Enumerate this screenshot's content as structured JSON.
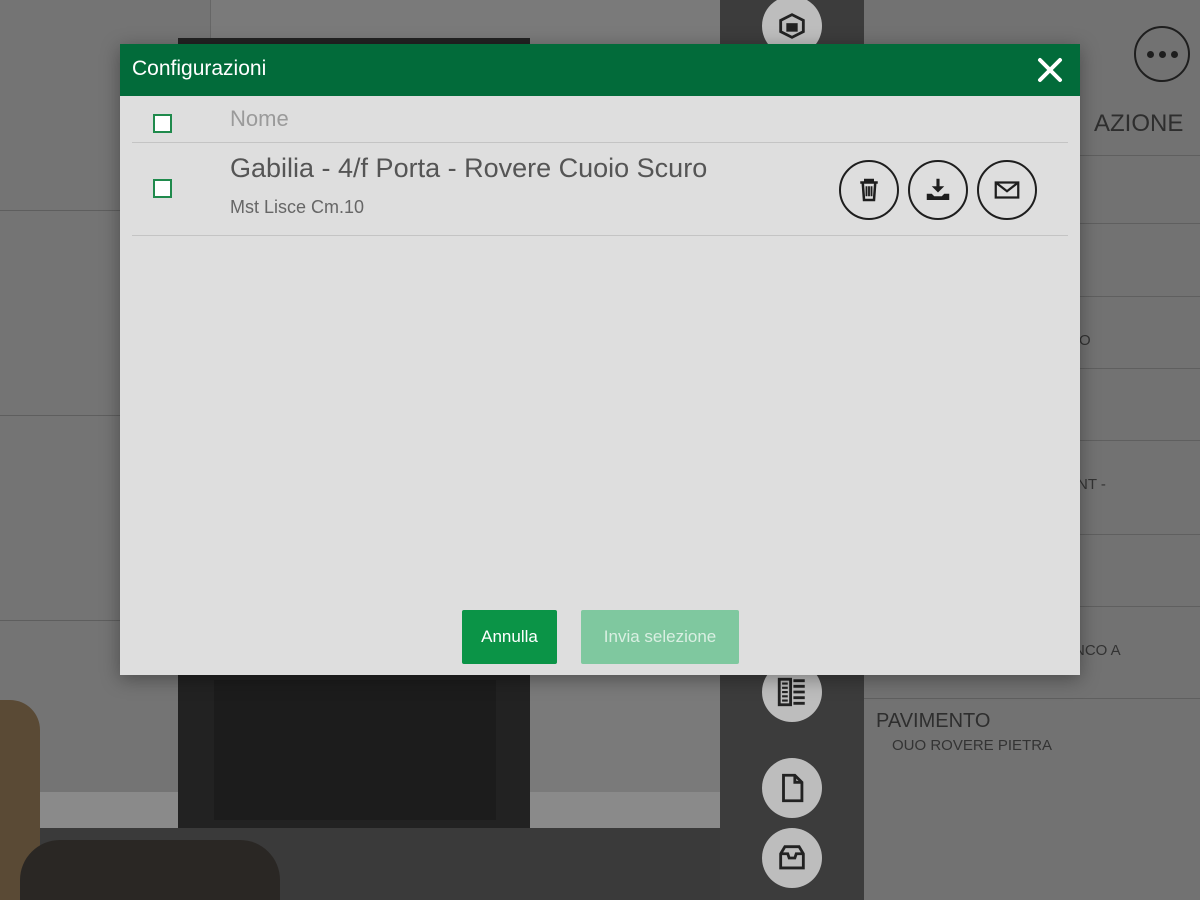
{
  "colors": {
    "header_green": "#026b3a",
    "button_green": "#0b9447",
    "button_disabled": "#7fc89f",
    "modal_bg": "#dedede"
  },
  "background_panel": {
    "more_button_icon": "more-dots-icon",
    "lines": [
      {
        "text": "AZIONE",
        "size": "large"
      },
      {
        "text": "O",
        "size": "small"
      },
      {
        "text": "NT -",
        "size": "small"
      },
      {
        "text": "NCO A",
        "size": "small"
      },
      {
        "text": "PAVIMENTO",
        "size": "large"
      },
      {
        "text": "OUO ROVERE PIETRA",
        "size": "small"
      }
    ]
  },
  "toolbar": {
    "icons": [
      "3d-cube-icon",
      "pattern-icon",
      "document-icon",
      "archive-box-icon"
    ]
  },
  "modal": {
    "title": "Configurazioni",
    "close_icon": "close-icon",
    "column_header": "Nome",
    "items": [
      {
        "title": "Gabilia - 4/f Porta - Rovere Cuoio Scuro",
        "subtitle": "Mst Lisce Cm.10",
        "checked": false,
        "actions": [
          "trash-icon",
          "download-icon",
          "email-icon"
        ]
      }
    ],
    "buttons": {
      "cancel": "Annulla",
      "send": "Invia selezione"
    }
  }
}
